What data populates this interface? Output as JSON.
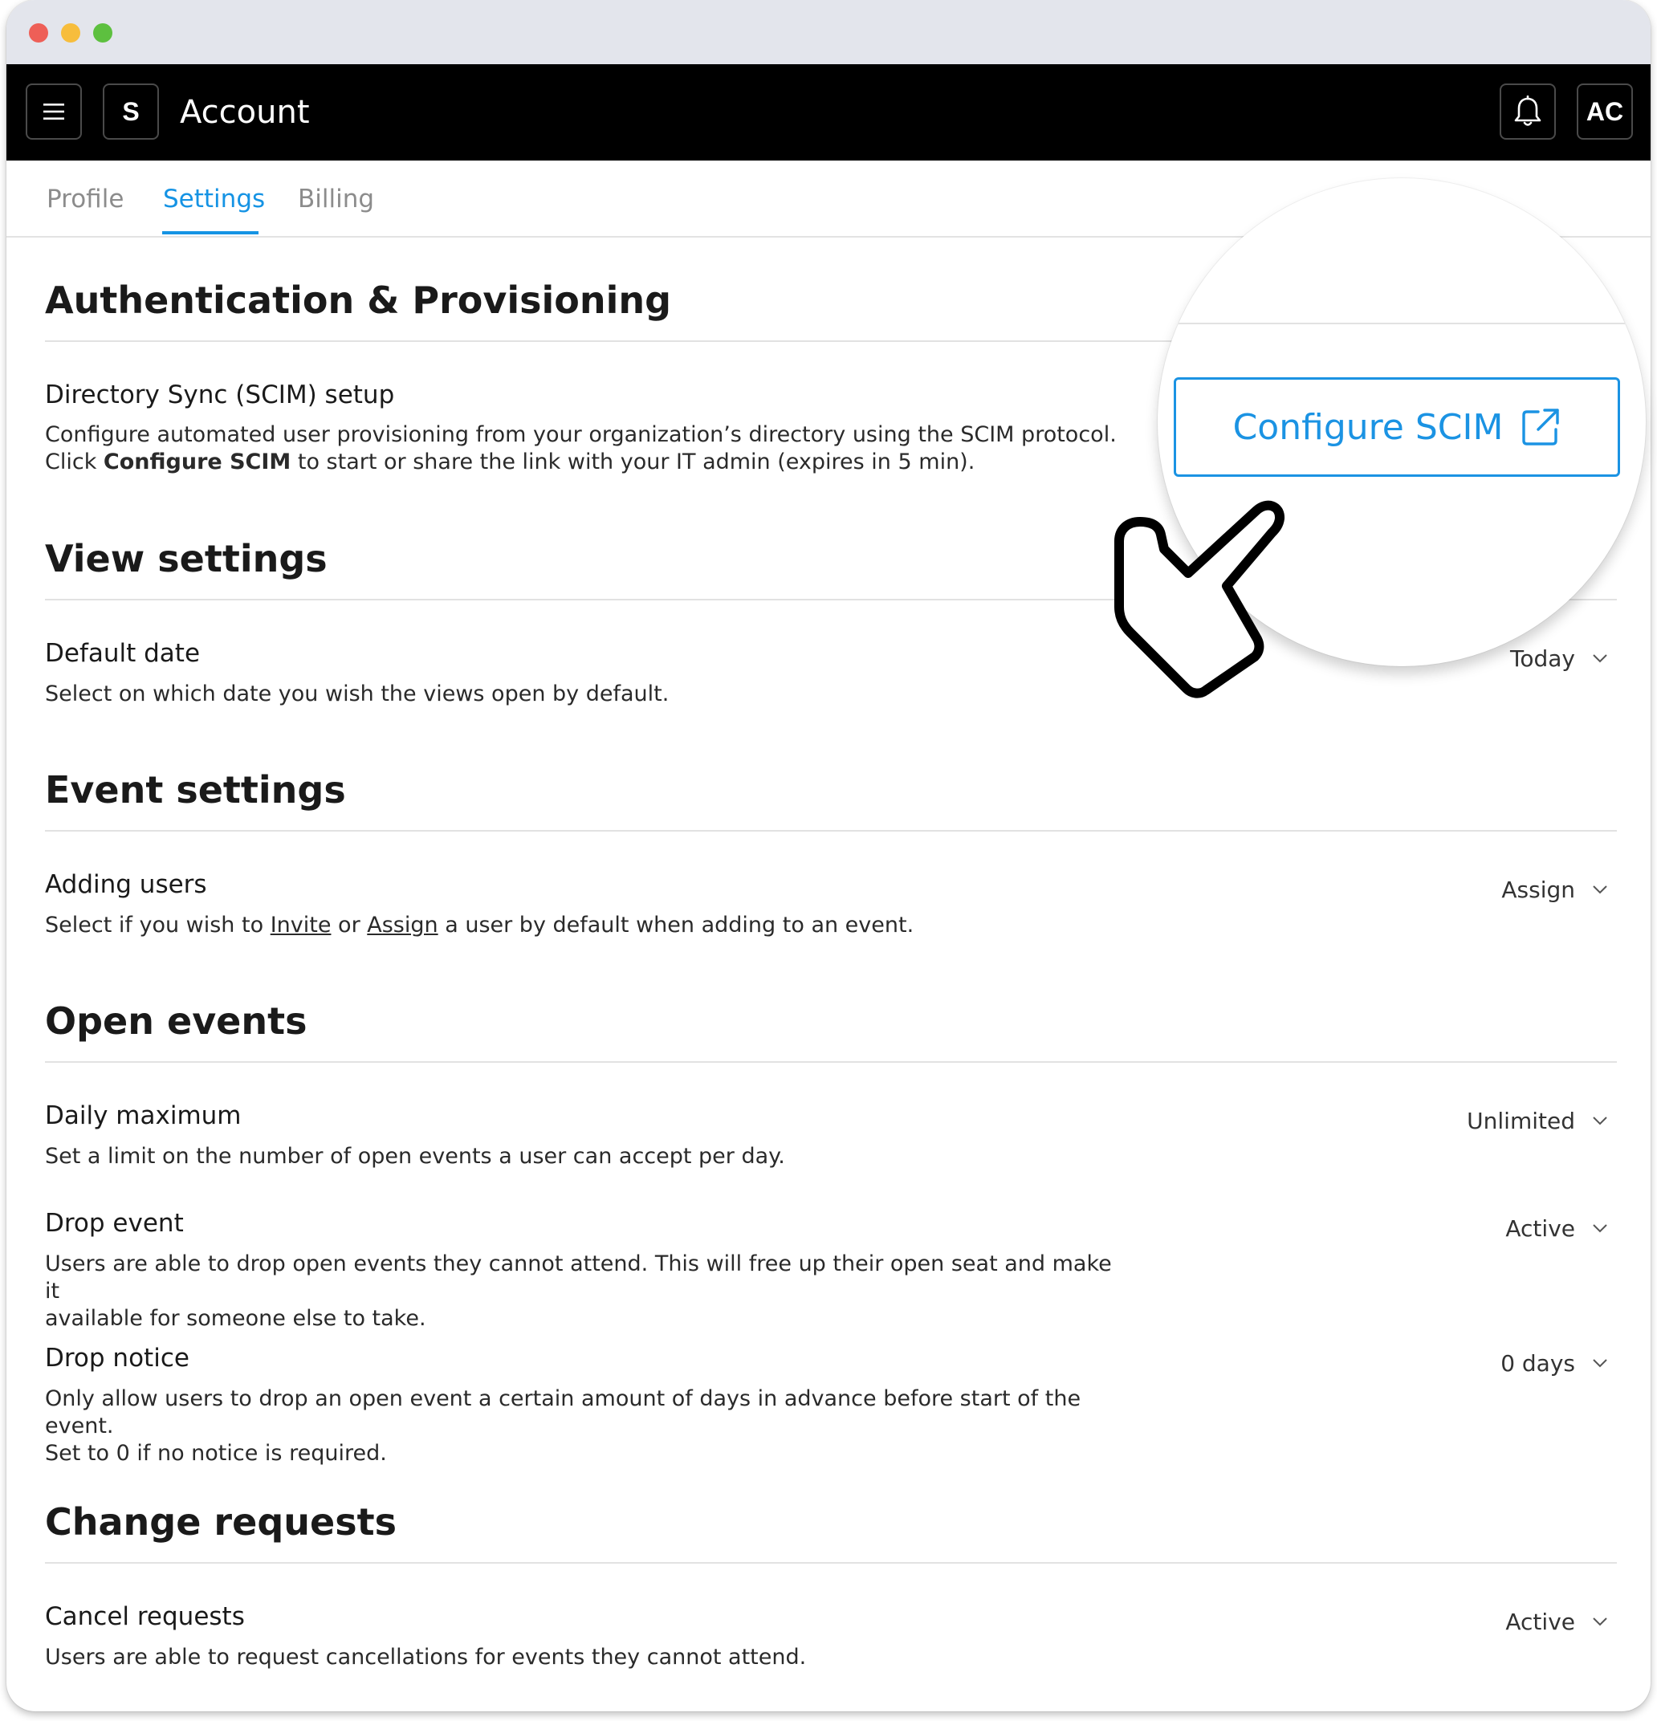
{
  "app": {
    "logo_letter": "S",
    "title": "Account",
    "avatar_initials": "AC"
  },
  "tabs": [
    {
      "label": "Profile",
      "active": false
    },
    {
      "label": "Settings",
      "active": true
    },
    {
      "label": "Billing",
      "active": false
    }
  ],
  "auth": {
    "title": "Authentication & Provisioning",
    "scim": {
      "title": "Directory Sync (SCIM) setup",
      "desc_line1": "Configure automated user provisioning from your organization’s directory using the SCIM protocol.",
      "desc_line2_pre": "Click ",
      "desc_line2_bold": "Configure SCIM",
      "desc_line2_post": " to start or share the link with your IT admin (expires in 5 min).",
      "button_label": "Configure SCIM"
    }
  },
  "view": {
    "title": "View settings",
    "default_date": {
      "title": "Default date",
      "desc": "Select on which date you wish the views open by default.",
      "value": "Today"
    }
  },
  "event": {
    "title": "Event settings",
    "adding_users": {
      "title": "Adding users",
      "desc_pre": "Select if you wish to ",
      "link_invite": "Invite",
      "desc_mid": " or ",
      "link_assign": "Assign",
      "desc_post": " a user by default when adding to an event.",
      "value": "Assign"
    }
  },
  "open_events": {
    "title": "Open events",
    "daily_max": {
      "title": "Daily maximum",
      "desc": "Set a limit on the number of open events a user can accept per day.",
      "value": "Unlimited"
    },
    "drop_event": {
      "title": "Drop event",
      "desc_line1": "Users are able to drop open events they cannot attend. This will free up their open seat and make it",
      "desc_line2": "available for someone else to take.",
      "value": "Active"
    },
    "drop_notice": {
      "title": "Drop notice",
      "desc_line1": "Only allow users to drop an open event a certain amount of days in advance before start of the event.",
      "desc_line2": "Set to 0 if no notice is required.",
      "value": "0 days"
    }
  },
  "change_requests": {
    "title": "Change requests",
    "cancel_requests": {
      "title": "Cancel requests",
      "desc": "Users are able to request cancellations for events they cannot attend.",
      "value": "Active"
    }
  },
  "colors": {
    "accent": "#1593e4",
    "appbar": "#000000",
    "titlebar": "#e3e5ec"
  },
  "icons": [
    "hamburger-menu-icon",
    "bell-icon",
    "external-link-icon",
    "chevron-down-icon",
    "pointer-cursor-icon"
  ]
}
